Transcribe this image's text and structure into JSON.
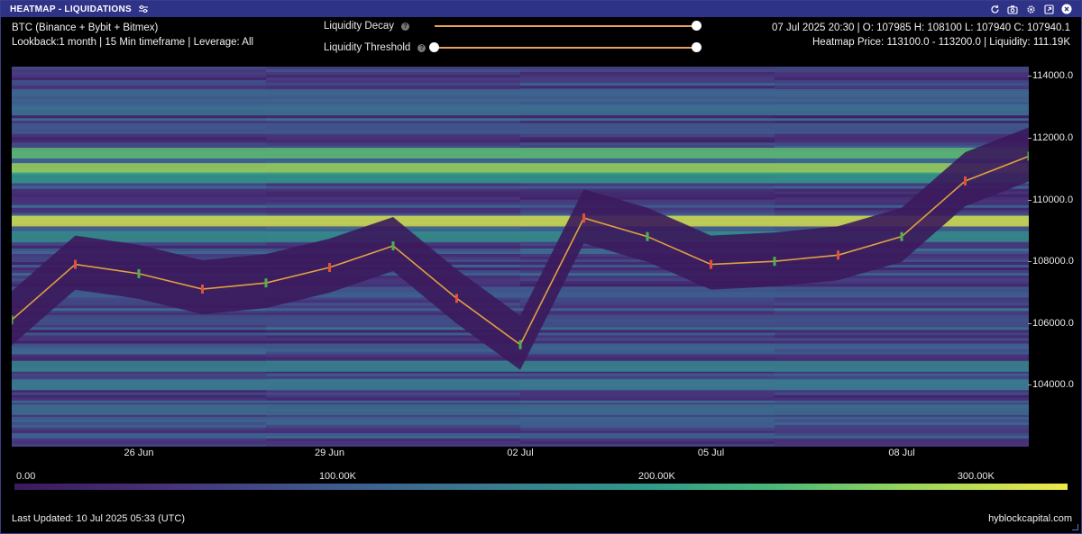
{
  "window": {
    "title": "HEATMAP - LIQUIDATIONS",
    "buttons": [
      "refresh-icon",
      "camera-icon",
      "gear-icon",
      "expand-icon",
      "close-icon"
    ]
  },
  "info": {
    "symbol": "BTC (Binance + Bybit + Bitmex)",
    "params": "Lookback:1 month | 15 Min timeframe | Leverage: All",
    "ohlc": "07 Jul 2025 20:30 | O: 107985 H: 108100 L: 107940 C: 107940.1",
    "heatmap_price": "Heatmap Price: 113100.0 - 113200.0 | Liquidity: 111.19K"
  },
  "controls": {
    "decay_label": "Liquidity Decay",
    "threshold_label": "Liquidity Threshold",
    "decay_value": 1.0,
    "threshold_value": 0.0,
    "accent": "#e8a05a"
  },
  "chart_data": {
    "type": "heatmap",
    "title": "",
    "x_ticks": [
      "26 Jun",
      "29 Jun",
      "02 Jul",
      "05 Jul",
      "08 Jul"
    ],
    "y_ticks": [
      "114000.0",
      "112000.0",
      "110000.0",
      "108000.0",
      "106000.0",
      "104000.0"
    ],
    "ylim": [
      102000,
      114300
    ],
    "colorscale_ticks": [
      "0.00",
      "100.00K",
      "200.00K",
      "300.00K"
    ],
    "colorscale_range": [
      0,
      330000
    ],
    "price_series": [
      {
        "x": "24 Jun",
        "y": 106100
      },
      {
        "x": "25 Jun",
        "y": 107900
      },
      {
        "x": "26 Jun",
        "y": 107600
      },
      {
        "x": "27 Jun",
        "y": 107100
      },
      {
        "x": "28 Jun",
        "y": 107300
      },
      {
        "x": "29 Jun",
        "y": 107800
      },
      {
        "x": "30 Jun",
        "y": 108500
      },
      {
        "x": "01 Jul",
        "y": 106800
      },
      {
        "x": "02 Jul",
        "y": 105300
      },
      {
        "x": "03 Jul",
        "y": 109400
      },
      {
        "x": "04 Jul",
        "y": 108800
      },
      {
        "x": "05 Jul",
        "y": 107900
      },
      {
        "x": "06 Jul",
        "y": 108000
      },
      {
        "x": "07 Jul",
        "y": 108200
      },
      {
        "x": "08 Jul",
        "y": 108800
      },
      {
        "x": "09 Jul",
        "y": 110600
      },
      {
        "x": "10 Jul",
        "y": 111400
      }
    ],
    "liquidity_bands": [
      {
        "price": 113400,
        "level": 0.35
      },
      {
        "price": 112900,
        "level": 0.4
      },
      {
        "price": 112300,
        "level": 0.3
      },
      {
        "price": 111500,
        "level": 0.75
      },
      {
        "price": 111000,
        "level": 0.85
      },
      {
        "price": 110700,
        "level": 0.6
      },
      {
        "price": 109300,
        "level": 0.95
      },
      {
        "price": 108800,
        "level": 0.55
      },
      {
        "price": 107000,
        "level": 0.3
      },
      {
        "price": 106100,
        "level": 0.25
      },
      {
        "price": 104600,
        "level": 0.5
      },
      {
        "price": 104000,
        "level": 0.45
      },
      {
        "price": 103200,
        "level": 0.4
      }
    ]
  },
  "footer": {
    "updated": "Last Updated: 10 Jul 2025 05:33 (UTC)",
    "brand": "hyblockcapital.com"
  }
}
